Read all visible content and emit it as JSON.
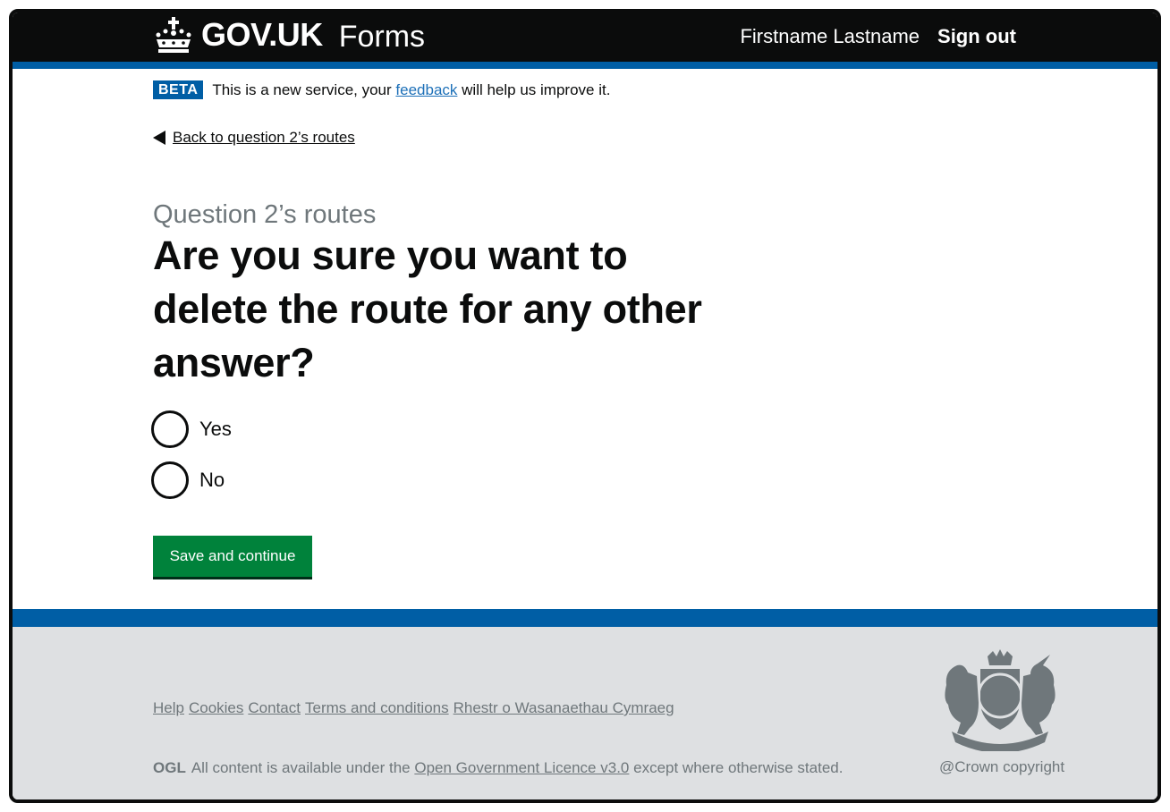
{
  "header": {
    "logo_text": "GOV.UK",
    "product_name": "Forms",
    "user_name": "Firstname Lastname",
    "sign_out": "Sign out"
  },
  "phase_banner": {
    "tag": "BETA",
    "text_before": "This is a new service, your",
    "link": "feedback",
    "text_after": "will help us improve it."
  },
  "back_link": "Back to question 2’s routes",
  "caption": "Question 2’s routes",
  "heading": "Are you sure you want to delete the route for any other answer?",
  "radios": [
    {
      "label": "Yes",
      "selected": false
    },
    {
      "label": "No",
      "selected": false
    }
  ],
  "submit_button": "Save and continue",
  "footer": {
    "links": [
      "Help",
      "Cookies",
      "Contact",
      "Terms and conditions",
      "Rhestr o Wasanaethau Cymraeg"
    ],
    "ogl": "OGL",
    "licence_before": "All content is available under the",
    "licence_link": "Open Government Licence v3.0",
    "licence_after": "except where otherwise stated.",
    "copyright": "@Crown copyright"
  },
  "colors": {
    "header_bg": "#0b0c0c",
    "brand_blue": "#005ea5",
    "button_green": "#00823b",
    "footer_bg": "#dee0e2",
    "secondary_text": "#6f777b"
  }
}
